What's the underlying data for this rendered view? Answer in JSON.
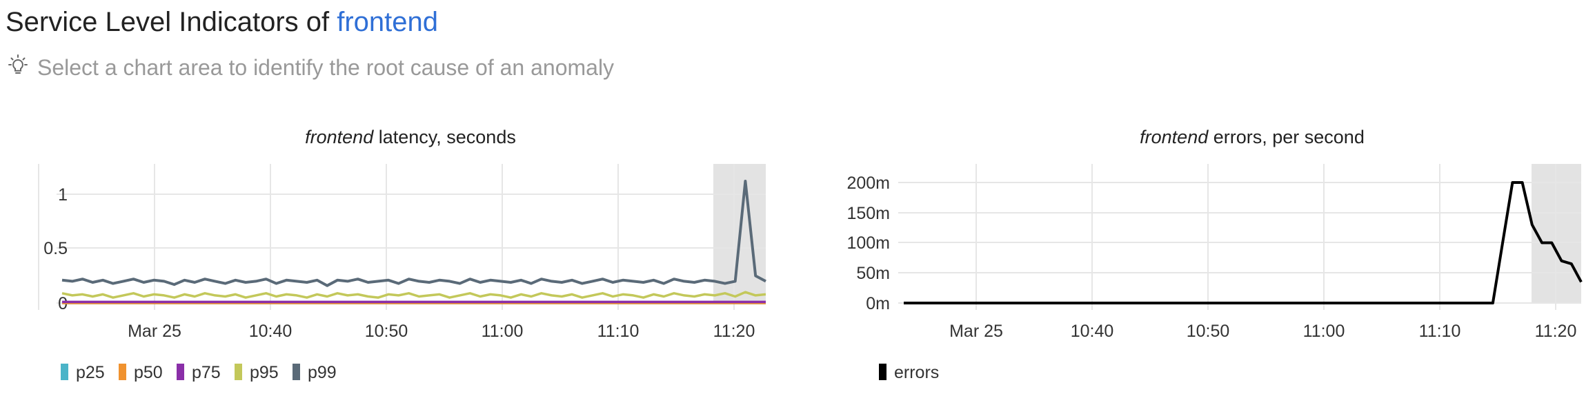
{
  "page": {
    "title_prefix": "Service Level Indicators of",
    "service_name": "frontend",
    "hint_text": "Select a chart area to identify the root cause of an anomaly",
    "hint_icon": "lightbulb-icon"
  },
  "colors": {
    "link": "#2f6fd6",
    "p25": "#4bb4c8",
    "p50": "#f0922f",
    "p75": "#8a2fa8",
    "p95": "#c3c85a",
    "p99": "#5a6a78",
    "errors": "#000000",
    "highlight": "#e3e3e3"
  },
  "chart_data": [
    {
      "type": "line",
      "title_service": "frontend",
      "title_rest": " latency, seconds",
      "xlabel": "",
      "ylabel": "",
      "x_ticks": [
        "Mar 25",
        "10:40",
        "10:50",
        "11:00",
        "11:10",
        "11:20"
      ],
      "y_ticks": [
        "1",
        "0.5",
        "0"
      ],
      "ylim": [
        0,
        1.25
      ],
      "grid": true,
      "legend_position": "bottom-left",
      "highlight_range_minutes": [
        3.7,
        4.0
      ],
      "series": [
        {
          "name": "p25",
          "color": "#4bb4c8",
          "values": [
            0,
            0,
            0,
            0,
            0,
            0,
            0,
            0,
            0,
            0,
            0,
            0,
            0,
            0,
            0,
            0,
            0,
            0,
            0,
            0,
            0,
            0,
            0,
            0,
            0,
            0,
            0,
            0,
            0,
            0,
            0,
            0,
            0,
            0,
            0,
            0,
            0,
            0,
            0,
            0,
            0,
            0,
            0,
            0,
            0,
            0,
            0,
            0,
            0,
            0,
            0,
            0,
            0,
            0,
            0,
            0,
            0,
            0,
            0,
            0,
            0,
            0,
            0,
            0,
            0,
            0,
            0,
            0,
            0,
            0
          ]
        },
        {
          "name": "p50",
          "color": "#f0922f",
          "values": [
            0,
            0,
            0,
            0,
            0,
            0,
            0,
            0,
            0,
            0,
            0,
            0,
            0,
            0,
            0,
            0,
            0,
            0,
            0,
            0,
            0,
            0,
            0,
            0,
            0,
            0,
            0,
            0,
            0,
            0,
            0,
            0,
            0,
            0,
            0,
            0,
            0,
            0,
            0,
            0,
            0,
            0,
            0,
            0,
            0,
            0,
            0,
            0,
            0,
            0,
            0,
            0,
            0,
            0,
            0,
            0,
            0,
            0,
            0,
            0,
            0,
            0,
            0,
            0,
            0,
            0,
            0,
            0,
            0,
            0
          ]
        },
        {
          "name": "p75",
          "color": "#8a2fa8",
          "values": [
            0.01,
            0.01,
            0.01,
            0.01,
            0.01,
            0.01,
            0.01,
            0.01,
            0.01,
            0.01,
            0.01,
            0.01,
            0.01,
            0.01,
            0.01,
            0.01,
            0.01,
            0.01,
            0.01,
            0.01,
            0.01,
            0.01,
            0.01,
            0.01,
            0.01,
            0.01,
            0.01,
            0.01,
            0.01,
            0.01,
            0.01,
            0.01,
            0.01,
            0.01,
            0.01,
            0.01,
            0.01,
            0.01,
            0.01,
            0.01,
            0.01,
            0.01,
            0.01,
            0.01,
            0.01,
            0.01,
            0.01,
            0.01,
            0.01,
            0.01,
            0.01,
            0.01,
            0.01,
            0.01,
            0.01,
            0.01,
            0.01,
            0.01,
            0.01,
            0.01,
            0.01,
            0.01,
            0.01,
            0.01,
            0.01,
            0.01,
            0.01,
            0.01,
            0.01,
            0.01
          ]
        },
        {
          "name": "p95",
          "color": "#c3c85a",
          "values": [
            0.09,
            0.07,
            0.08,
            0.06,
            0.08,
            0.05,
            0.07,
            0.09,
            0.06,
            0.08,
            0.07,
            0.05,
            0.08,
            0.06,
            0.09,
            0.07,
            0.06,
            0.08,
            0.05,
            0.07,
            0.09,
            0.06,
            0.08,
            0.07,
            0.05,
            0.08,
            0.06,
            0.09,
            0.07,
            0.08,
            0.06,
            0.05,
            0.08,
            0.07,
            0.09,
            0.06,
            0.07,
            0.08,
            0.05,
            0.07,
            0.09,
            0.06,
            0.08,
            0.07,
            0.05,
            0.08,
            0.06,
            0.09,
            0.07,
            0.06,
            0.08,
            0.05,
            0.07,
            0.09,
            0.06,
            0.08,
            0.07,
            0.05,
            0.08,
            0.06,
            0.09,
            0.07,
            0.06,
            0.08,
            0.07,
            0.09,
            0.06,
            0.1,
            0.07,
            0.08
          ]
        },
        {
          "name": "p99",
          "color": "#5a6a78",
          "values": [
            0.21,
            0.2,
            0.22,
            0.19,
            0.21,
            0.18,
            0.2,
            0.22,
            0.19,
            0.21,
            0.2,
            0.17,
            0.21,
            0.19,
            0.22,
            0.2,
            0.18,
            0.21,
            0.19,
            0.2,
            0.22,
            0.18,
            0.21,
            0.2,
            0.19,
            0.21,
            0.16,
            0.21,
            0.2,
            0.22,
            0.19,
            0.2,
            0.21,
            0.18,
            0.22,
            0.2,
            0.19,
            0.21,
            0.2,
            0.18,
            0.22,
            0.19,
            0.21,
            0.2,
            0.19,
            0.21,
            0.18,
            0.22,
            0.2,
            0.19,
            0.21,
            0.18,
            0.2,
            0.22,
            0.19,
            0.21,
            0.2,
            0.19,
            0.21,
            0.18,
            0.22,
            0.2,
            0.19,
            0.21,
            0.2,
            0.18,
            0.2,
            1.12,
            0.25,
            0.2
          ]
        }
      ]
    },
    {
      "type": "line",
      "title_service": "frontend",
      "title_rest": " errors, per second",
      "xlabel": "",
      "ylabel": "",
      "x_ticks": [
        "Mar 25",
        "10:40",
        "10:50",
        "11:00",
        "11:10",
        "11:20"
      ],
      "y_ticks": [
        "200m",
        "150m",
        "100m",
        "50m",
        "0m"
      ],
      "ylim": [
        0,
        0.2
      ],
      "grid": true,
      "legend_position": "bottom-left",
      "highlight_range_minutes": [
        3.7,
        4.0
      ],
      "series": [
        {
          "name": "errors",
          "color": "#000000",
          "values": [
            0,
            0,
            0,
            0,
            0,
            0,
            0,
            0,
            0,
            0,
            0,
            0,
            0,
            0,
            0,
            0,
            0,
            0,
            0,
            0,
            0,
            0,
            0,
            0,
            0,
            0,
            0,
            0,
            0,
            0,
            0,
            0,
            0,
            0,
            0,
            0,
            0,
            0,
            0,
            0,
            0,
            0,
            0,
            0,
            0,
            0,
            0,
            0,
            0,
            0,
            0,
            0,
            0,
            0,
            0,
            0,
            0,
            0,
            0,
            0,
            0,
            0.1,
            0.2,
            0.2,
            0.13,
            0.1,
            0.1,
            0.07,
            0.065,
            0.035
          ]
        }
      ]
    }
  ]
}
